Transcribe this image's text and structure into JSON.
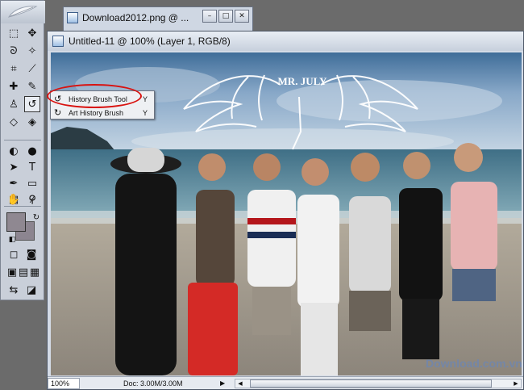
{
  "windows": {
    "back": {
      "title": "Download2012.png @ ..."
    },
    "main": {
      "title": "Untitled-11 @ 100% (Layer 1, RGB/8)"
    }
  },
  "window_controls": {
    "minimize": "–",
    "maximize": "□",
    "close": "✕"
  },
  "toolbox": {
    "tools": [
      {
        "name": "marquee-tool-icon",
        "glyph": "⬚"
      },
      {
        "name": "move-tool-icon",
        "glyph": "✥"
      },
      {
        "name": "lasso-tool-icon",
        "glyph": "ᘐ"
      },
      {
        "name": "magic-wand-icon",
        "glyph": "✧"
      },
      {
        "name": "crop-tool-icon",
        "glyph": "⌗"
      },
      {
        "name": "slice-tool-icon",
        "glyph": "⟋"
      },
      {
        "name": "healing-brush-icon",
        "glyph": "✚"
      },
      {
        "name": "brush-tool-icon",
        "glyph": "✎"
      },
      {
        "name": "clone-stamp-icon",
        "glyph": "♙"
      },
      {
        "name": "history-brush-tool-icon",
        "glyph": "↺"
      },
      {
        "name": "eraser-tool-icon",
        "glyph": "◇"
      },
      {
        "name": "paint-bucket-icon",
        "glyph": "◈"
      },
      {
        "name": "blur-tool-icon",
        "glyph": "◐"
      },
      {
        "name": "dodge-tool-icon",
        "glyph": "●"
      },
      {
        "name": "path-selection-icon",
        "glyph": "➤"
      },
      {
        "name": "type-tool-icon",
        "glyph": "T"
      },
      {
        "name": "pen-tool-icon",
        "glyph": "✒"
      },
      {
        "name": "shape-tool-icon",
        "glyph": "▭"
      },
      {
        "name": "notes-tool-icon",
        "glyph": "▤"
      },
      {
        "name": "eyedropper-icon",
        "glyph": "⌿"
      },
      {
        "name": "hand-tool-icon",
        "glyph": "✋"
      },
      {
        "name": "zoom-tool-icon",
        "glyph": "⚲"
      }
    ],
    "colors": {
      "foreground": "#8f8891",
      "background": "#8c8590"
    }
  },
  "flyout": {
    "items": [
      {
        "icon": "history-brush-icon",
        "glyph": "↺",
        "label": "History Brush Tool",
        "shortcut": "Y"
      },
      {
        "icon": "art-history-brush-icon",
        "glyph": "↻",
        "label": "Art History Brush",
        "shortcut": "Y"
      }
    ]
  },
  "photo": {
    "watermark": "MR. JULY",
    "bottom_watermark": "Download.com.vn"
  },
  "statusbar": {
    "zoom": "100%",
    "doc": "Doc: 3.00M/3.00M",
    "arrow": "▶"
  }
}
